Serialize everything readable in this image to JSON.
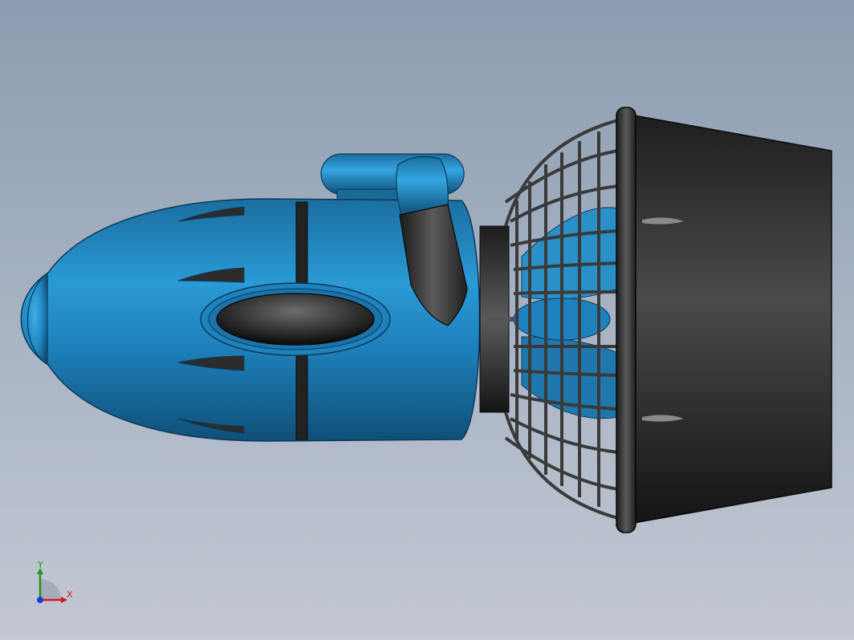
{
  "viewport": {
    "background_top": "#8c9cb0",
    "background_bottom": "#c3c8d3"
  },
  "model": {
    "name": "underwater-scooter",
    "body_color": "#1f7fb8",
    "handle_color": "#2e2e2e",
    "cage_color": "#3a3a3a",
    "shroud_color": "#2f2f2f"
  },
  "triad": {
    "x_label": "X",
    "y_label": "Y",
    "x_color": "#d01a1a",
    "y_color": "#1a9a1a",
    "z_color": "#1a3fd0"
  }
}
